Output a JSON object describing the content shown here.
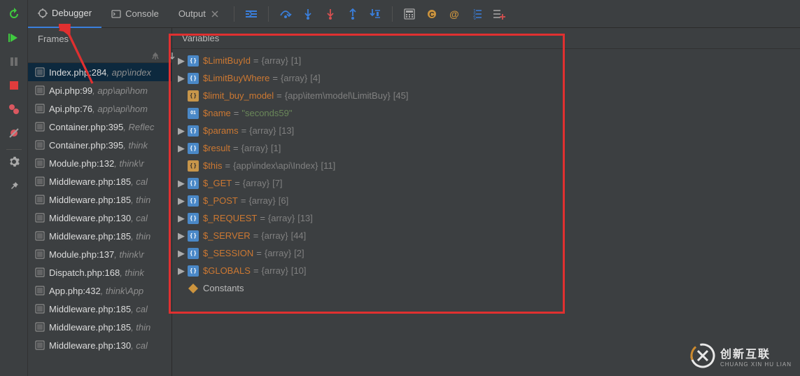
{
  "tabs": {
    "debugger": "Debugger",
    "console": "Console",
    "output": "Output"
  },
  "panels": {
    "frames_title": "Frames",
    "vars_title": "Variables"
  },
  "frames": [
    {
      "file": "Index.php:284",
      "loc": ", app\\index",
      "selected": true
    },
    {
      "file": "Api.php:99",
      "loc": ", app\\api\\hom",
      "selected": false
    },
    {
      "file": "Api.php:76",
      "loc": ", app\\api\\hom",
      "selected": false
    },
    {
      "file": "Container.php:395",
      "loc": ", Reflec",
      "selected": false
    },
    {
      "file": "Container.php:395",
      "loc": ", think",
      "selected": false
    },
    {
      "file": "Module.php:132",
      "loc": ", think\\r",
      "selected": false
    },
    {
      "file": "Middleware.php:185",
      "loc": ", cal",
      "selected": false
    },
    {
      "file": "Middleware.php:185",
      "loc": ", thin",
      "selected": false
    },
    {
      "file": "Middleware.php:130",
      "loc": ", cal",
      "selected": false
    },
    {
      "file": "Middleware.php:185",
      "loc": ", thin",
      "selected": false
    },
    {
      "file": "Module.php:137",
      "loc": ", think\\r",
      "selected": false
    },
    {
      "file": "Dispatch.php:168",
      "loc": ", think",
      "selected": false
    },
    {
      "file": "App.php:432",
      "loc": ", think\\App",
      "selected": false
    },
    {
      "file": "Middleware.php:185",
      "loc": ", cal",
      "selected": false
    },
    {
      "file": "Middleware.php:185",
      "loc": ", thin",
      "selected": false
    },
    {
      "file": "Middleware.php:130",
      "loc": ", cal",
      "selected": false
    }
  ],
  "vars": [
    {
      "expand": true,
      "badge": "array",
      "name": "$LimitBuyId",
      "eq": " = ",
      "val": "{array}",
      "count": "[1]"
    },
    {
      "expand": true,
      "badge": "array",
      "name": "$LimitBuyWhere",
      "eq": " = ",
      "val": "{array}",
      "count": "[4]"
    },
    {
      "expand": false,
      "badge": "obj",
      "name": "$limit_buy_model",
      "eq": " = ",
      "val": "{app\\item\\model\\LimitBuy}",
      "count": "[45]"
    },
    {
      "expand": false,
      "badge": "str",
      "name": "$name",
      "name_blue": true,
      "eq": " = ",
      "str": "\"seconds59\""
    },
    {
      "expand": true,
      "badge": "array",
      "name": "$params",
      "eq": " = ",
      "val": "{array}",
      "count": "[13]"
    },
    {
      "expand": true,
      "badge": "array",
      "name": "$result",
      "eq": " = ",
      "val": "{array}",
      "count": "[1]"
    },
    {
      "expand": false,
      "badge": "obj",
      "name": "$this",
      "eq": " = ",
      "val": "{app\\index\\api\\Index}",
      "count": "[11]"
    },
    {
      "expand": true,
      "badge": "array",
      "name": "$_GET",
      "name_blue": true,
      "eq": " = ",
      "val": "{array}",
      "count": "[7]"
    },
    {
      "expand": true,
      "badge": "array",
      "name": "$_POST",
      "name_blue": true,
      "eq": " = ",
      "val": "{array}",
      "count": "[6]"
    },
    {
      "expand": true,
      "badge": "array",
      "name": "$_REQUEST",
      "name_blue": true,
      "eq": " = ",
      "val": "{array}",
      "count": "[13]"
    },
    {
      "expand": true,
      "badge": "array",
      "name": "$_SERVER",
      "name_blue": true,
      "eq": " = ",
      "val": "{array}",
      "count": "[44]"
    },
    {
      "expand": true,
      "badge": "array",
      "name": "$_SESSION",
      "name_blue": true,
      "eq": " = ",
      "val": "{array}",
      "count": "[2]"
    },
    {
      "expand": true,
      "badge": "array",
      "name": "$GLOBALS",
      "name_blue": true,
      "eq": " = ",
      "val": "{array}",
      "count": "[10]"
    },
    {
      "expand": false,
      "badge": "const",
      "name": "Constants",
      "name_plain": true
    }
  ],
  "watermark": {
    "cn": "创新互联",
    "py": "CHUANG XIN HU LIAN"
  }
}
